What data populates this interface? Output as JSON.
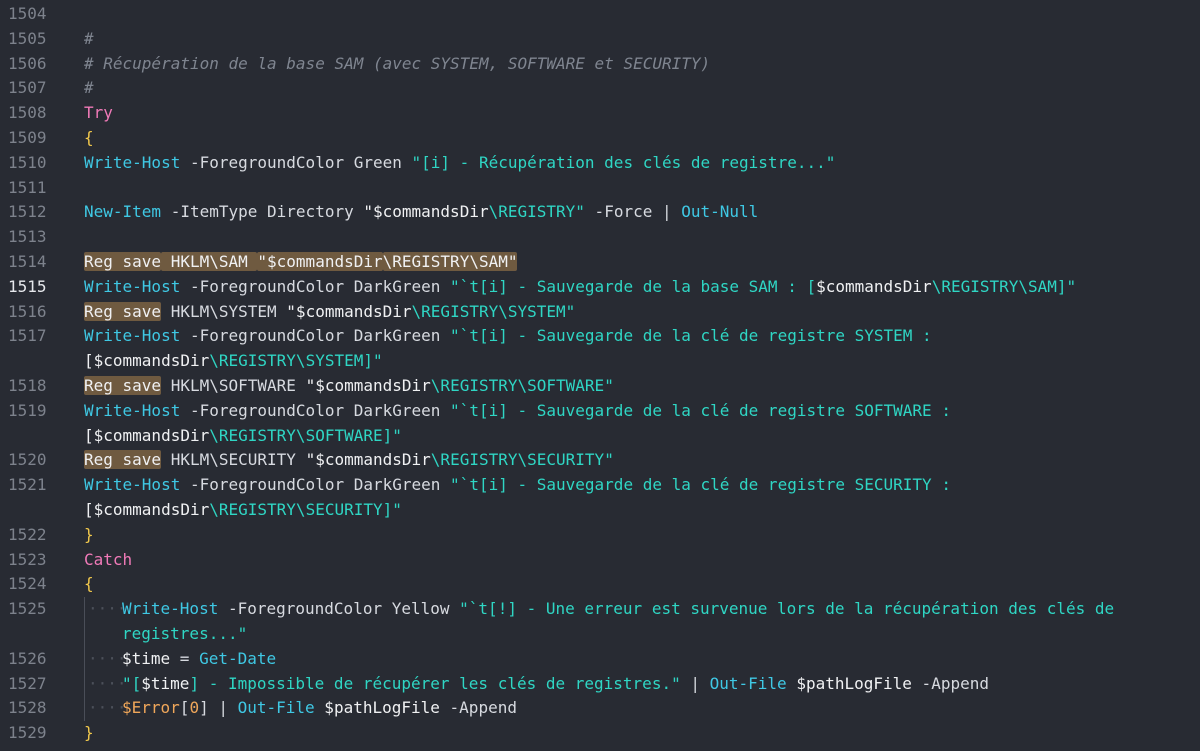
{
  "editor": {
    "language": "PowerShell",
    "current_line": 1515,
    "lines": [
      {
        "n": "1504",
        "tokens": []
      },
      {
        "n": "1505",
        "tokens": [
          {
            "c": "cm",
            "t": "#"
          }
        ]
      },
      {
        "n": "1506",
        "tokens": [
          {
            "c": "cm",
            "t": "# Récupération de la base SAM (avec SYSTEM, SOFTWARE et SECURITY)"
          }
        ]
      },
      {
        "n": "1507",
        "tokens": [
          {
            "c": "cm",
            "t": "#"
          }
        ]
      },
      {
        "n": "1508",
        "tokens": [
          {
            "c": "kw",
            "t": "Try"
          }
        ]
      },
      {
        "n": "1509",
        "tokens": [
          {
            "c": "br",
            "t": "{"
          }
        ]
      },
      {
        "n": "1510",
        "tokens": [
          {
            "c": "cmd",
            "t": "Write-Host"
          },
          {
            "c": "pm",
            "t": " -ForegroundColor Green "
          },
          {
            "c": "str",
            "t": "\"[i] - Récupération des clés de registre...\""
          }
        ]
      },
      {
        "n": "1511",
        "tokens": []
      },
      {
        "n": "1512",
        "tokens": [
          {
            "c": "cmd",
            "t": "New-Item"
          },
          {
            "c": "pm",
            "t": " -ItemType Directory "
          },
          {
            "c": "var",
            "t": "\"$commandsDir"
          },
          {
            "c": "str",
            "t": "\\REGISTRY\""
          },
          {
            "c": "pm",
            "t": " -Force | "
          },
          {
            "c": "cmd",
            "t": "Out-Null"
          }
        ]
      },
      {
        "n": "1513",
        "tokens": []
      },
      {
        "n": "1514",
        "hlline": true,
        "tokens": [
          {
            "c": "hl",
            "t": "Reg save"
          },
          {
            "c": "hlrest",
            "t": " HKLM\\SAM "
          },
          {
            "c": "hlvar",
            "t": "\"$commandsDir"
          },
          {
            "c": "hlstr",
            "t": "\\REGISTRY\\SAM\""
          }
        ]
      },
      {
        "n": "1515",
        "tokens": [
          {
            "c": "cmd",
            "t": "Write-Host"
          },
          {
            "c": "pm",
            "t": " -ForegroundColor DarkGreen "
          },
          {
            "c": "str",
            "t": "\"`t[i] - Sauvegarde de la base SAM : ["
          },
          {
            "c": "var",
            "t": "$commandsDir"
          },
          {
            "c": "str",
            "t": "\\REGISTRY\\SAM]\""
          }
        ]
      },
      {
        "n": "1516",
        "tokens": [
          {
            "c": "hl",
            "t": "Reg save"
          },
          {
            "c": "pm",
            "t": " HKLM\\SYSTEM "
          },
          {
            "c": "var",
            "t": "\"$commandsDir"
          },
          {
            "c": "str",
            "t": "\\REGISTRY\\SYSTEM\""
          }
        ]
      },
      {
        "n": "1517",
        "tokens": [
          {
            "c": "cmd",
            "t": "Write-Host"
          },
          {
            "c": "pm",
            "t": " -ForegroundColor DarkGreen "
          },
          {
            "c": "str",
            "t": "\"`t[i] - Sauvegarde de la clé de registre SYSTEM :"
          }
        ],
        "cont": [
          {
            "c": "var",
            "t": "[$commandsDir"
          },
          {
            "c": "str",
            "t": "\\REGISTRY\\SYSTEM]\""
          }
        ]
      },
      {
        "n": "1518",
        "tokens": [
          {
            "c": "hl",
            "t": "Reg save"
          },
          {
            "c": "pm",
            "t": " HKLM\\SOFTWARE "
          },
          {
            "c": "var",
            "t": "\"$commandsDir"
          },
          {
            "c": "str",
            "t": "\\REGISTRY\\SOFTWARE\""
          }
        ]
      },
      {
        "n": "1519",
        "tokens": [
          {
            "c": "cmd",
            "t": "Write-Host"
          },
          {
            "c": "pm",
            "t": " -ForegroundColor DarkGreen "
          },
          {
            "c": "str",
            "t": "\"`t[i] - Sauvegarde de la clé de registre SOFTWARE :"
          }
        ],
        "cont": [
          {
            "c": "var",
            "t": "[$commandsDir"
          },
          {
            "c": "str",
            "t": "\\REGISTRY\\SOFTWARE]\""
          }
        ]
      },
      {
        "n": "1520",
        "tokens": [
          {
            "c": "hl",
            "t": "Reg save"
          },
          {
            "c": "pm",
            "t": " HKLM\\SECURITY "
          },
          {
            "c": "var",
            "t": "\"$commandsDir"
          },
          {
            "c": "str",
            "t": "\\REGISTRY\\SECURITY\""
          }
        ]
      },
      {
        "n": "1521",
        "tokens": [
          {
            "c": "cmd",
            "t": "Write-Host"
          },
          {
            "c": "pm",
            "t": " -ForegroundColor DarkGreen "
          },
          {
            "c": "str",
            "t": "\"`t[i] - Sauvegarde de la clé de registre SECURITY :"
          }
        ],
        "cont": [
          {
            "c": "var",
            "t": "[$commandsDir"
          },
          {
            "c": "str",
            "t": "\\REGISTRY\\SECURITY]\""
          }
        ]
      },
      {
        "n": "1522",
        "tokens": [
          {
            "c": "br",
            "t": "}"
          }
        ]
      },
      {
        "n": "1523",
        "tokens": [
          {
            "c": "kw",
            "t": "Catch"
          }
        ]
      },
      {
        "n": "1524",
        "tokens": [
          {
            "c": "br",
            "t": "{"
          }
        ]
      },
      {
        "n": "1525",
        "indent": true,
        "tokens": [
          {
            "c": "cmd",
            "t": "Write-Host"
          },
          {
            "c": "pm",
            "t": " -ForegroundColor Yellow "
          },
          {
            "c": "str",
            "t": "\"`t[!] - Une erreur est survenue lors de la récupération des clés de"
          }
        ],
        "cont": [
          {
            "c": "str",
            "t": "registres...\""
          }
        ]
      },
      {
        "n": "1526",
        "indent": true,
        "tokens": [
          {
            "c": "var",
            "t": "$time"
          },
          {
            "c": "pm",
            "t": " = "
          },
          {
            "c": "cmd",
            "t": "Get-Date"
          }
        ]
      },
      {
        "n": "1527",
        "indent": true,
        "tokens": [
          {
            "c": "str",
            "t": "\"["
          },
          {
            "c": "var",
            "t": "$time"
          },
          {
            "c": "str",
            "t": "] - Impossible de récupérer les clés de registres.\""
          },
          {
            "c": "pm",
            "t": " | "
          },
          {
            "c": "cmd",
            "t": "Out-File"
          },
          {
            "c": "var",
            "t": " $pathLogFile"
          },
          {
            "c": "pm",
            "t": " -Append"
          }
        ]
      },
      {
        "n": "1528",
        "indent": true,
        "tokens": [
          {
            "c": "err",
            "t": "$Error"
          },
          {
            "c": "pm",
            "t": "["
          },
          {
            "c": "err",
            "t": "0"
          },
          {
            "c": "pm",
            "t": "] | "
          },
          {
            "c": "cmd",
            "t": "Out-File"
          },
          {
            "c": "var",
            "t": " $pathLogFile"
          },
          {
            "c": "pm",
            "t": " -Append"
          }
        ]
      },
      {
        "n": "1529",
        "tokens": [
          {
            "c": "br",
            "t": "}"
          }
        ]
      }
    ]
  },
  "colors": {
    "background": "#282b33",
    "comment": "#7f8590",
    "keyword": "#f07ab8",
    "bracket": "#f2c94c",
    "cmdlet": "#3fc8e4",
    "string": "#2fd6c4",
    "highlight": "#6f5a40"
  }
}
